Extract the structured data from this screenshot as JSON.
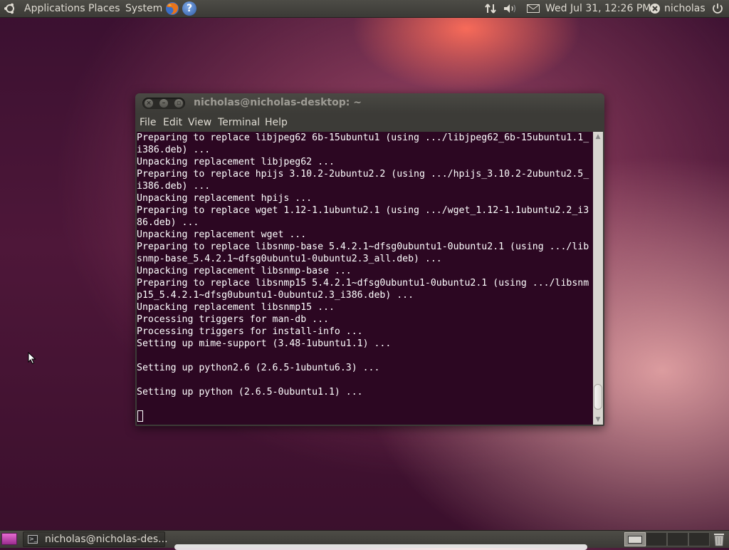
{
  "top_panel": {
    "menus": [
      "Applications",
      "Places",
      "System"
    ],
    "clock": "Wed Jul 31, 12:26 PM",
    "user": "nicholas",
    "icons": [
      "ubuntu-logo",
      "firefox-icon",
      "help-icon",
      "network-icon",
      "volume-icon",
      "mail-icon",
      "user-status-icon",
      "power-icon"
    ]
  },
  "window": {
    "title": "nicholas@nicholas-desktop: ~",
    "menu": [
      "File",
      "Edit",
      "View",
      "Terminal",
      "Help"
    ]
  },
  "terminal": {
    "background": "#2c0722",
    "lines": [
      "Preparing to replace libjpeg62 6b-15ubuntu1 (using .../libjpeg62_6b-15ubuntu1.1_",
      "i386.deb) ...",
      "Unpacking replacement libjpeg62 ...",
      "Preparing to replace hpijs 3.10.2-2ubuntu2.2 (using .../hpijs_3.10.2-2ubuntu2.5_",
      "i386.deb) ...",
      "Unpacking replacement hpijs ...",
      "Preparing to replace wget 1.12-1.1ubuntu2.1 (using .../wget_1.12-1.1ubuntu2.2_i3",
      "86.deb) ...",
      "Unpacking replacement wget ...",
      "Preparing to replace libsnmp-base 5.4.2.1~dfsg0ubuntu1-0ubuntu2.1 (using .../lib",
      "snmp-base_5.4.2.1~dfsg0ubuntu1-0ubuntu2.3_all.deb) ...",
      "Unpacking replacement libsnmp-base ...",
      "Preparing to replace libsnmp15 5.4.2.1~dfsg0ubuntu1-0ubuntu2.1 (using .../libsnm",
      "p15_5.4.2.1~dfsg0ubuntu1-0ubuntu2.3_i386.deb) ...",
      "Unpacking replacement libsnmp15 ...",
      "Processing triggers for man-db ...",
      "Processing triggers for install-info ...",
      "Setting up mime-support (3.48-1ubuntu1.1) ...",
      "",
      "Setting up python2.6 (2.6.5-1ubuntu6.3) ...",
      "",
      "Setting up python (2.6.5-0ubuntu1.1) ...",
      ""
    ]
  },
  "bottom_panel": {
    "task_label": "nicholas@nicholas-des...",
    "workspaces": 4,
    "active_workspace": 1
  }
}
